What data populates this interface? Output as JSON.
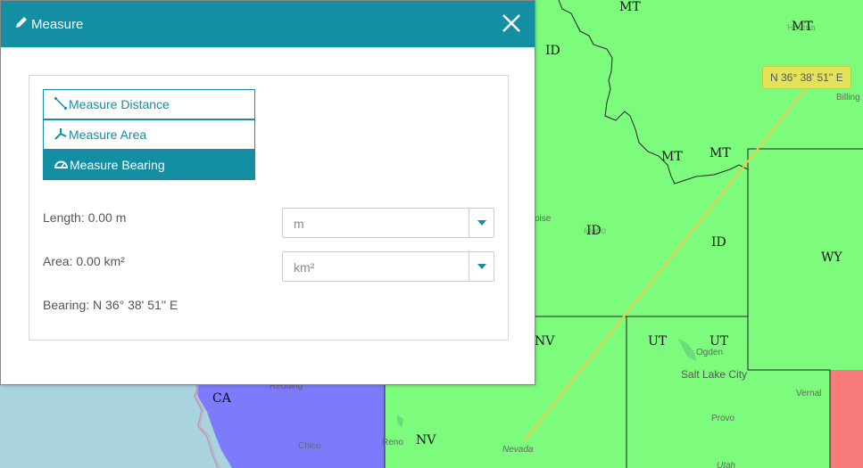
{
  "dialog": {
    "title": "Measure",
    "tools": [
      {
        "label": "Measure Distance",
        "icon": "measure-distance-icon",
        "active": false
      },
      {
        "label": "Measure Area",
        "icon": "measure-area-icon",
        "active": false
      },
      {
        "label": "Measure Bearing",
        "icon": "measure-bearing-icon",
        "active": true
      }
    ],
    "length_label": "Length: 0.00 m",
    "length_unit": "m",
    "area_label": "Area: 0.00 km²",
    "area_unit": "km²",
    "bearing_label": "Bearing: N 36° 38' 51'' E"
  },
  "map": {
    "bearing_tooltip": "N 36° 38' 51'' E",
    "state_labels": {
      "mt1": "MT",
      "mt2": "MT",
      "mt3": "MT",
      "mt4": "MT",
      "id1": "ID",
      "id2": "ID",
      "id3": "ID",
      "wy": "WY",
      "nv1": "NV",
      "nv2": "NV",
      "ut1": "UT",
      "ut2": "UT",
      "ca": "CA"
    },
    "city_labels": {
      "billings": "Billing",
      "helena": "Helena",
      "boise": "oise",
      "ogden": "Ogden",
      "slc": "Salt Lake City",
      "provo": "Provo",
      "vernal": "Vernal",
      "redding": "Redding",
      "chico": "Chico",
      "reno": "Reno",
      "nevada": "Nevada",
      "utah": "Utah",
      "idaho": "Idaho"
    },
    "colors": {
      "water": "#a9d3df",
      "green": "#7cfb7c",
      "blue": "#7b7bfb",
      "red": "#f87b7b",
      "line": "#f2c94c",
      "accent": "#138ea2"
    }
  }
}
